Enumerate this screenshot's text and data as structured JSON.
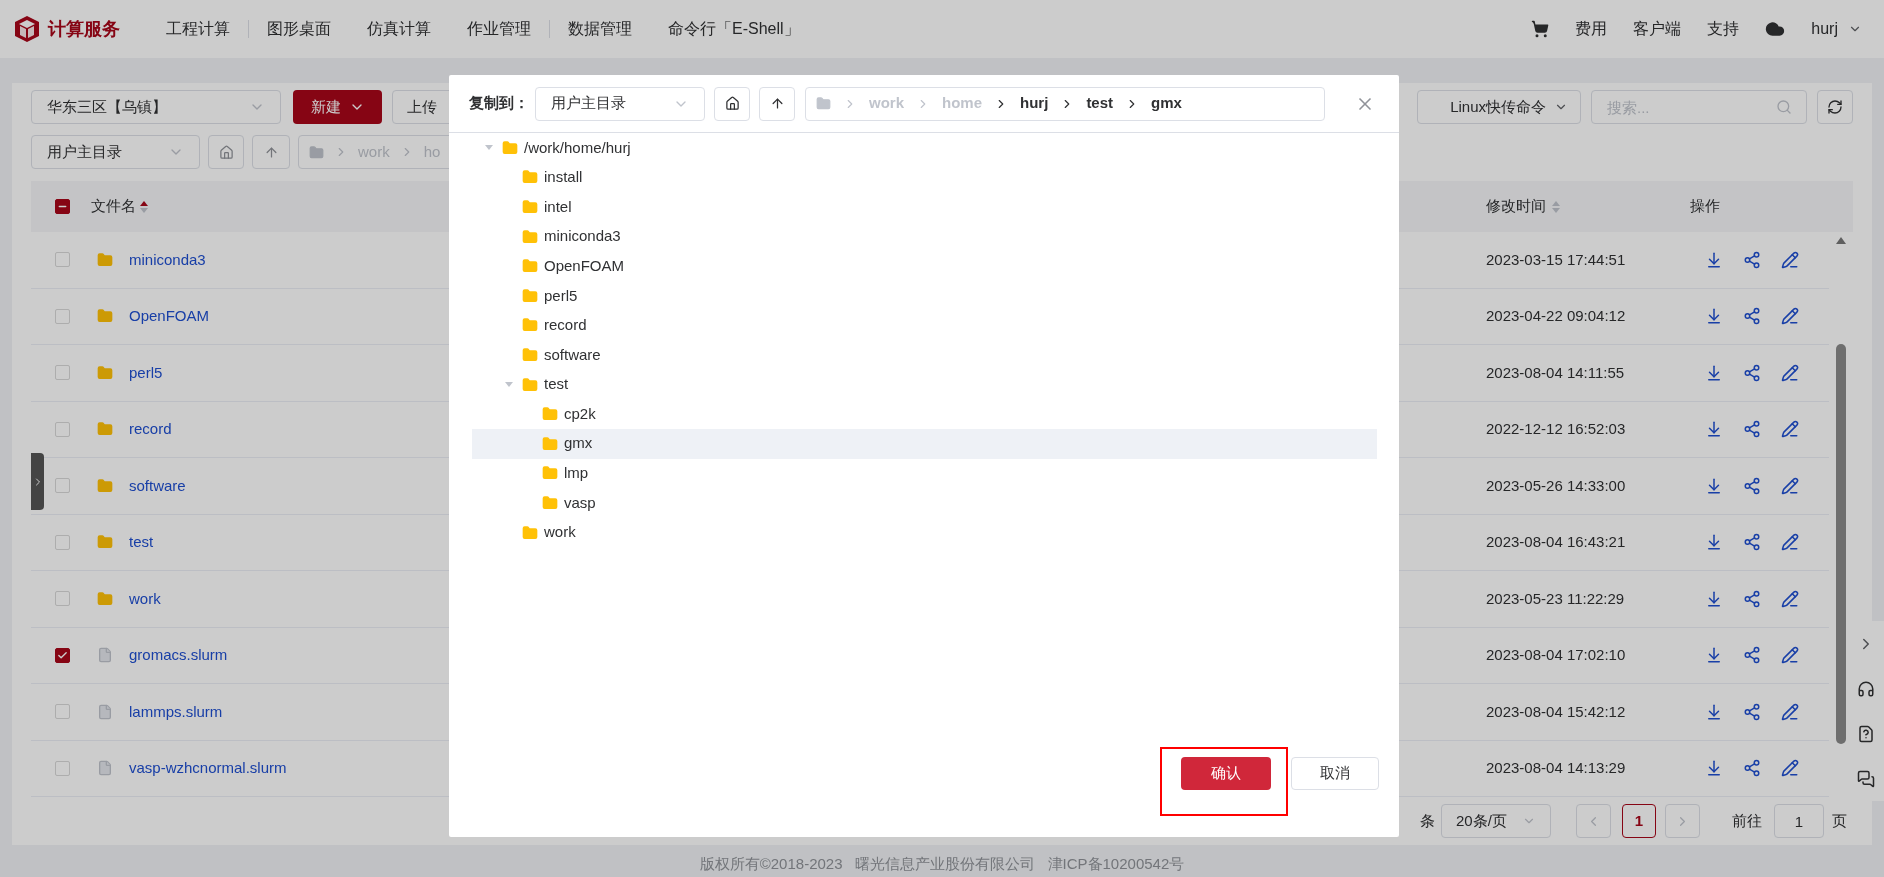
{
  "header": {
    "brand": "计算服务",
    "nav": [
      {
        "label": "工程计算",
        "group_end": true
      },
      {
        "label": "图形桌面",
        "group_end": false
      },
      {
        "label": "仿真计算",
        "group_end": false
      },
      {
        "label": "作业管理",
        "group_end": true
      },
      {
        "label": "数据管理",
        "group_end": false
      },
      {
        "label": "命令行「E-Shell」",
        "group_end": false
      }
    ],
    "right_links": [
      "费用",
      "客户端",
      "支持"
    ],
    "user": "hurj"
  },
  "toolbar": {
    "region": "华东三区【乌镇】",
    "new_button": "新建",
    "upload_button": "上传",
    "linux_select": "Linux快传命令",
    "search": {
      "placeholder": "搜索..."
    }
  },
  "path_bar": {
    "root_select": "用户主目录",
    "crumbs": [
      "work",
      "ho"
    ]
  },
  "table": {
    "select_all_partial": true,
    "columns": [
      "文件名",
      "修改时间",
      "操作"
    ],
    "rows": [
      {
        "name": "miniconda3",
        "kind": "folder",
        "checked": false,
        "modified": "2023-03-15 17:44:51"
      },
      {
        "name": "OpenFOAM",
        "kind": "folder",
        "checked": false,
        "modified": "2023-04-22 09:04:12"
      },
      {
        "name": "perl5",
        "kind": "folder",
        "checked": false,
        "modified": "2023-08-04 14:11:55"
      },
      {
        "name": "record",
        "kind": "folder",
        "checked": false,
        "modified": "2022-12-12 16:52:03"
      },
      {
        "name": "software",
        "kind": "folder",
        "checked": false,
        "modified": "2023-05-26 14:33:00"
      },
      {
        "name": "test",
        "kind": "folder",
        "checked": false,
        "modified": "2023-08-04 16:43:21"
      },
      {
        "name": "work",
        "kind": "folder",
        "checked": false,
        "modified": "2023-05-23 11:22:29"
      },
      {
        "name": "gromacs.slurm",
        "kind": "file",
        "checked": true,
        "modified": "2023-08-04 17:02:10"
      },
      {
        "name": "lammps.slurm",
        "kind": "file",
        "checked": false,
        "modified": "2023-08-04 15:42:12"
      },
      {
        "name": "vasp-wzhcnormal.slurm",
        "kind": "file",
        "checked": false,
        "modified": "2023-08-04 14:13:29"
      }
    ]
  },
  "pagination": {
    "total_suffix": "条",
    "page_size": "20条/页",
    "pages": [
      {
        "label": "1",
        "selected": true
      }
    ],
    "goto_label": "前往",
    "goto_value": "1",
    "goto_suffix": "页"
  },
  "footer": "版权所有©2018-2023   曙光信息产业股份有限公司   津ICP备10200542号",
  "dialog": {
    "label": "复制到：",
    "root_select": "用户主目录",
    "crumbs": [
      {
        "label": "work",
        "disabled": true
      },
      {
        "label": "home",
        "disabled": true
      },
      {
        "label": "hurj",
        "disabled": false
      },
      {
        "label": "test",
        "disabled": false
      },
      {
        "label": "gmx",
        "disabled": false
      }
    ],
    "tree": [
      {
        "label": "/work/home/hurj",
        "expanded": true,
        "selected": false,
        "children": [
          {
            "label": "install",
            "selected": false
          },
          {
            "label": "intel",
            "selected": false
          },
          {
            "label": "miniconda3",
            "selected": false
          },
          {
            "label": "OpenFOAM",
            "selected": false
          },
          {
            "label": "perl5",
            "selected": false
          },
          {
            "label": "record",
            "selected": false
          },
          {
            "label": "software",
            "selected": false
          },
          {
            "label": "test",
            "expanded": true,
            "selected": false,
            "children": [
              {
                "label": "cp2k",
                "selected": false
              },
              {
                "label": "gmx",
                "selected": true
              },
              {
                "label": "lmp",
                "selected": false
              },
              {
                "label": "vasp",
                "selected": false
              }
            ]
          },
          {
            "label": "work",
            "selected": false
          }
        ]
      }
    ],
    "confirm_button": "确认",
    "cancel_button": "取消"
  }
}
